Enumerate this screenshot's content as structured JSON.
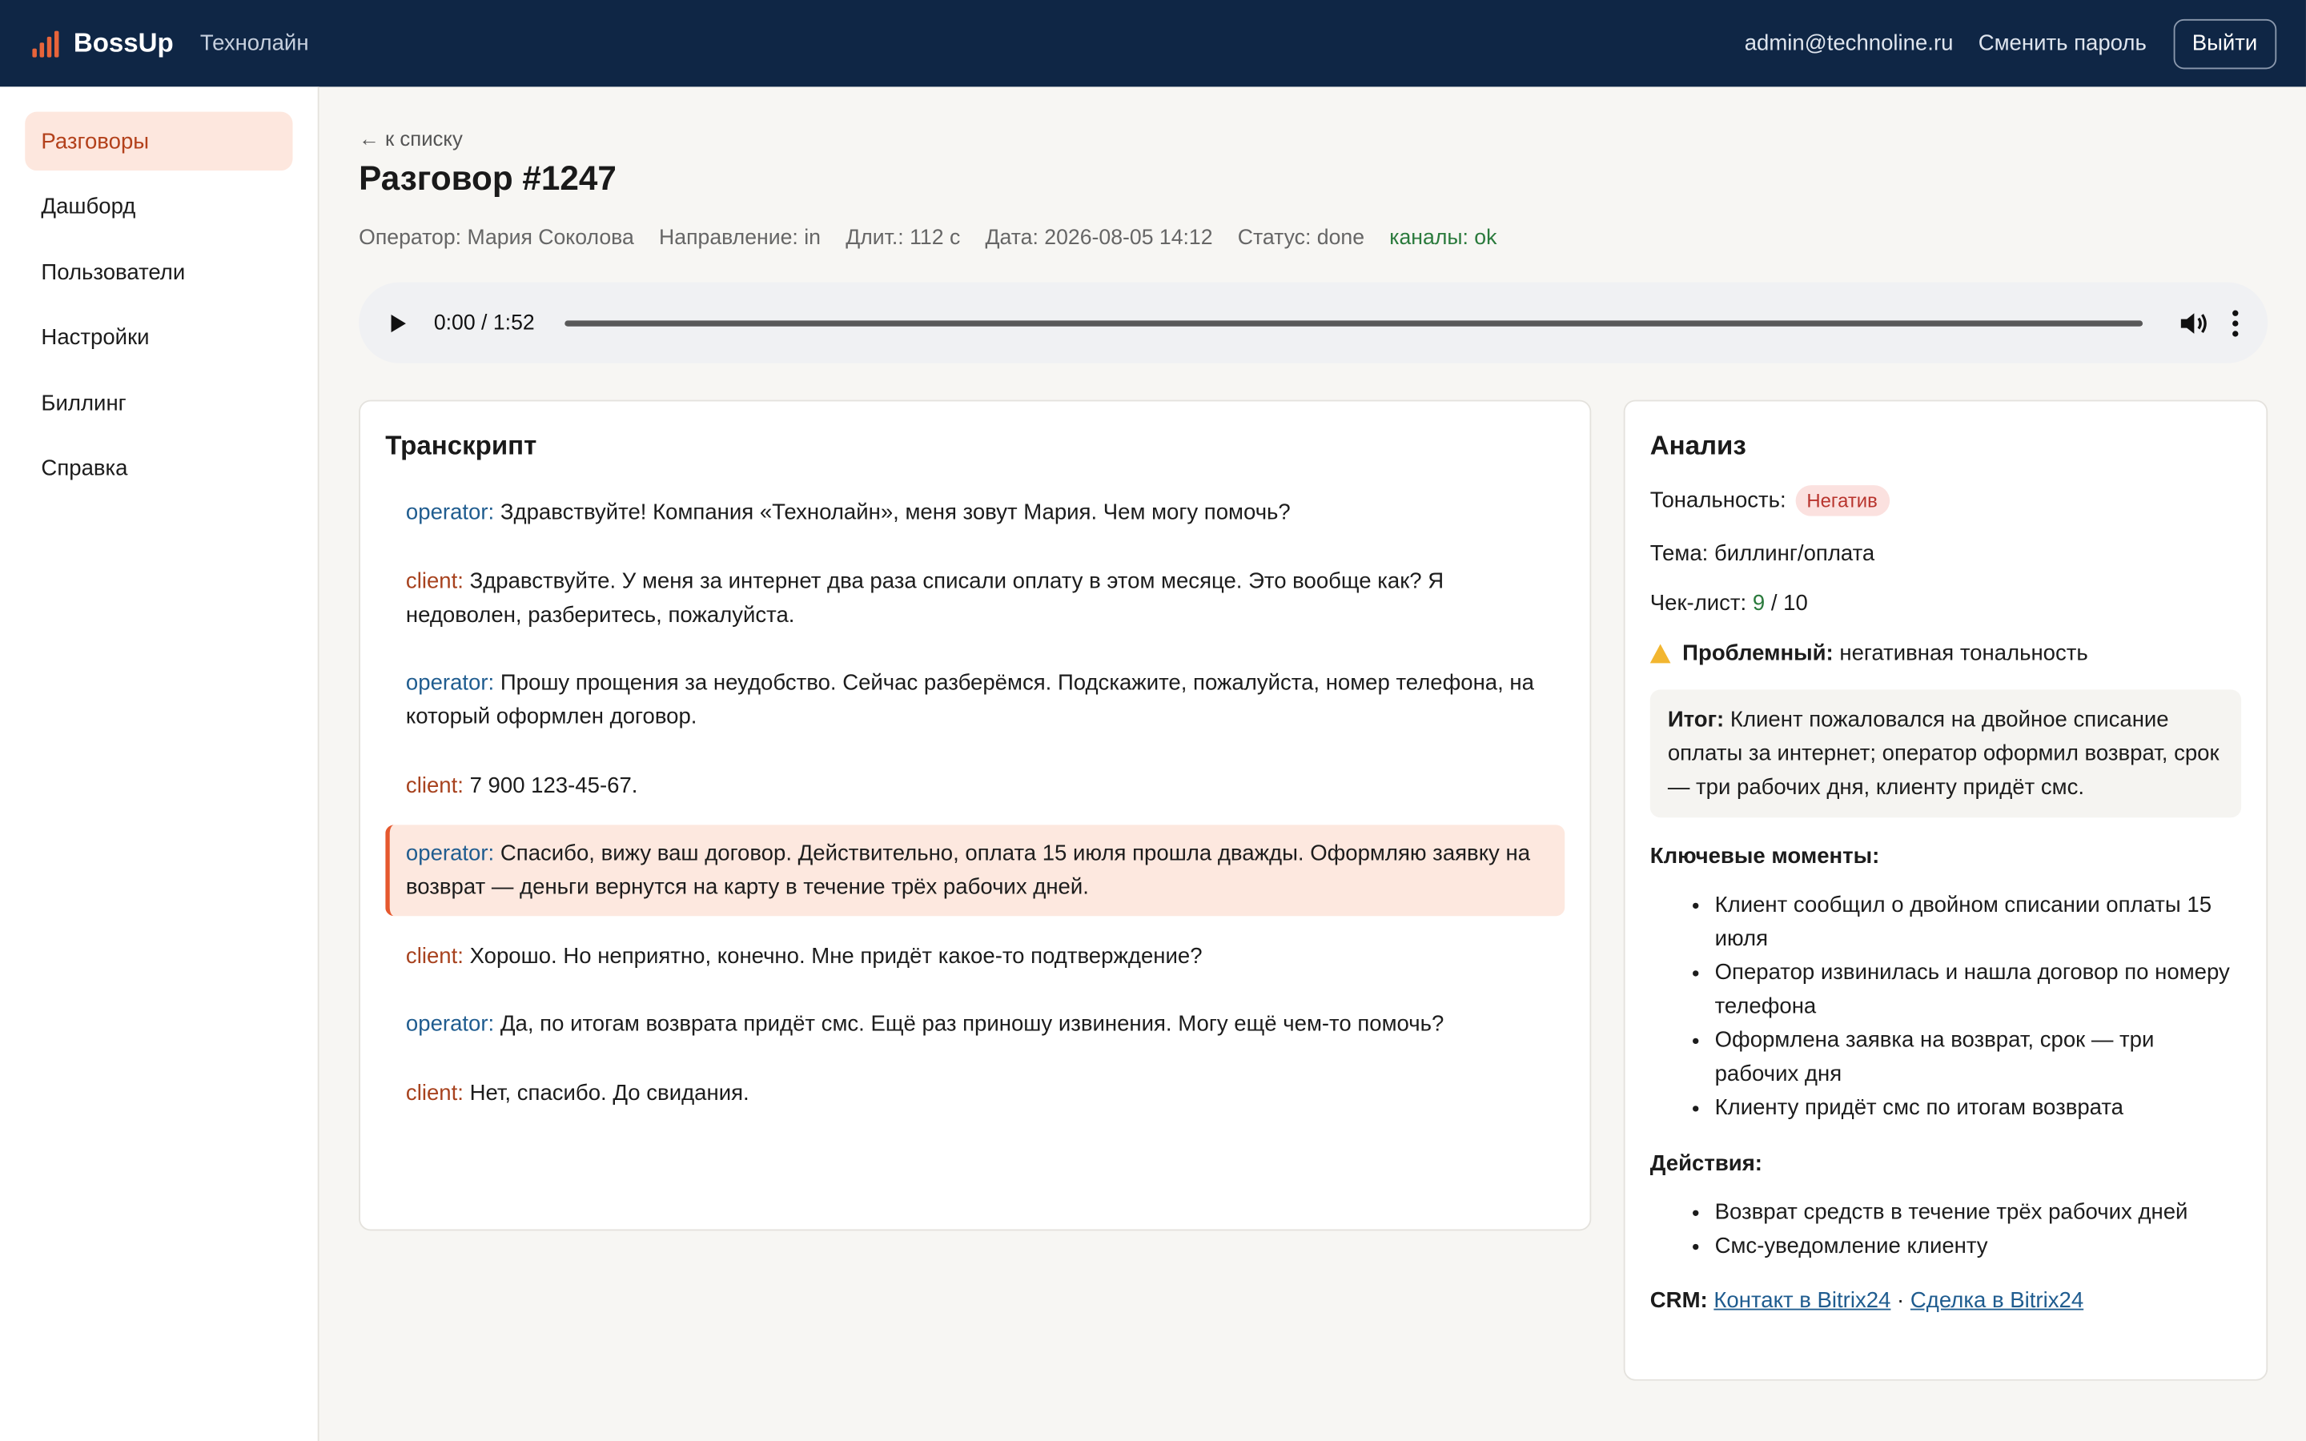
{
  "header": {
    "brand": "BossUp",
    "company": "Технолайн",
    "email": "admin@technoline.ru",
    "change_password": "Сменить пароль",
    "logout": "Выйти",
    "accent_color": "#e8643a",
    "bg_color": "#0f2645"
  },
  "sidebar": {
    "items": [
      {
        "label": "Разговоры",
        "active": true
      },
      {
        "label": "Дашборд"
      },
      {
        "label": "Пользователи"
      },
      {
        "label": "Настройки"
      },
      {
        "label": "Биллинг"
      },
      {
        "label": "Справка"
      }
    ]
  },
  "call": {
    "back": "к списку",
    "title": "Разговор #1247",
    "meta": {
      "operator": "Оператор: Мария Соколова",
      "direction": "Направление: in",
      "duration": "Длит.: 112 с",
      "date": "Дата: 2026-08-05 14:12",
      "status": "Статус: done",
      "channels": "каналы: ok"
    },
    "player": {
      "time": "0:00 / 1:52"
    }
  },
  "transcript": {
    "title": "Транскрипт",
    "messages": [
      {
        "speaker": "operator:",
        "text": "Здравствуйте! Компания «Технолайн», меня зовут Мария. Чем могу помочь?"
      },
      {
        "speaker": "client:",
        "text": "Здравствуйте. У меня за интернет два раза списали оплату в этом месяце. Это вообще как? Я недоволен, разберитесь, пожалуйста."
      },
      {
        "speaker": "operator:",
        "text": "Прошу прощения за неудобство. Сейчас разберёмся. Подскажите, пожалуйста, номер телефона, на который оформлен договор."
      },
      {
        "speaker": "client:",
        "text": "7 900 123-45-67."
      },
      {
        "speaker": "operator:",
        "text": "Спасибо, вижу ваш договор. Действительно, оплата 15 июля прошла дважды. Оформляю заявку на возврат — деньги вернутся на карту в течение трёх рабочих дней.",
        "highlighted": true
      },
      {
        "speaker": "client:",
        "text": "Хорошо. Но неприятно, конечно. Мне придёт какое-то подтверждение?"
      },
      {
        "speaker": "operator:",
        "text": "Да, по итогам возврата придёт смс. Ещё раз приношу извинения. Могу ещё чем-то помочь?"
      },
      {
        "speaker": "client:",
        "text": "Нет, спасибо. До свидания."
      }
    ]
  },
  "analysis": {
    "title": "Анализ",
    "tone_label": "Тональность:",
    "tone_value": "Негатив",
    "topic": "Тема: биллинг/оплата",
    "checklist_label": "Чек-лист:",
    "checklist_score": "9",
    "checklist_total": "/ 10",
    "problem_label": "Проблемный:",
    "problem_text": "негативная тональность",
    "summary_label": "Итог:",
    "summary_text": "Клиент пожаловался на двойное списание оплаты за интернет; оператор оформил возврат, срок — три рабочих дня, клиенту придёт смс.",
    "key_moments_title": "Ключевые моменты:",
    "key_moments": [
      "Клиент сообщил о двойном списании оплаты 15 июля",
      "Оператор извинилась и нашла договор по номеру телефона",
      "Оформлена заявка на возврат, срок — три рабочих дня",
      "Клиенту придёт смс по итогам возврата"
    ],
    "actions_title": "Действия:",
    "actions": [
      "Возврат средств в течение трёх рабочих дней",
      "Смс-уведомление клиенту"
    ],
    "crm_label": "CRM:",
    "crm_contact": "Контакт в Bitrix24",
    "crm_sep": "·",
    "crm_deal": "Сделка в Bitrix24"
  }
}
